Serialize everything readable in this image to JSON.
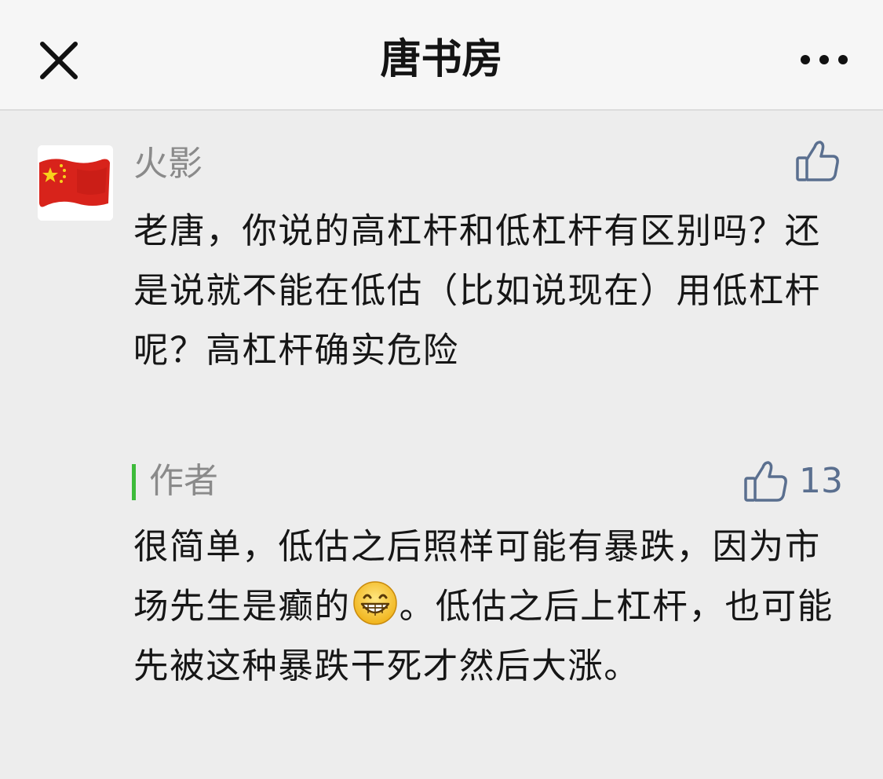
{
  "header": {
    "title": "唐书房",
    "close_icon": "close-icon",
    "more_icon": "more-dots-icon"
  },
  "comment": {
    "username": "火影",
    "avatar": "china-flag-avatar",
    "like_icon": "thumbs-up-icon",
    "text": "老唐，你说的高杠杆和低杠杆有区别吗？还是说就不能在低估（比如说现在）用低杠杆呢？高杠杆确实危险"
  },
  "reply": {
    "author_label": "作者",
    "like_count": "13",
    "like_icon": "thumbs-up-icon",
    "text_before_emoji": "很简单，低估之后照样可能有暴跌，因为市场先生是癫的",
    "emoji": "grinning-face-emoji",
    "text_after_emoji": "。低估之后上杠杆，也可能先被这种暴跌干死才然后大涨。"
  },
  "colors": {
    "accent_green": "#3dbb3a",
    "like_blue": "#5a6f8f",
    "muted_text": "#8a8a8a",
    "body_text": "#161616"
  }
}
